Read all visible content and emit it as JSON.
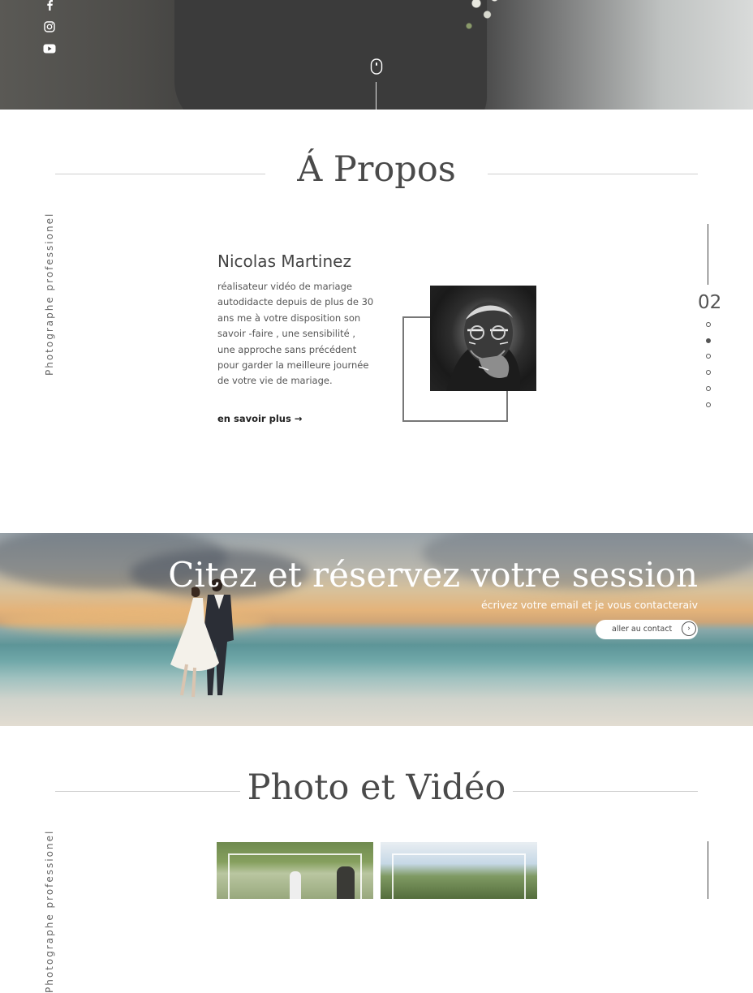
{
  "hero": {
    "social_icons": [
      "facebook-icon",
      "instagram-icon",
      "youtube-icon"
    ],
    "scroll_icon": "mouse-scroll-icon"
  },
  "about": {
    "title": "Á Propos",
    "side_label": "Photographe professionel",
    "name": "Nicolas Martinez",
    "description": "réalisateur vidéo de mariage autodidacte depuis de plus de 30 ans me à votre disposition son savoir -faire , une sensibilité , une approche sans précédent pour garder la meilleure journée de votre vie de mariage.",
    "more_link": "en savoir plus →",
    "portrait": "portrait-photo"
  },
  "pager": {
    "current": "02",
    "total_dots": 6,
    "active_index": 1
  },
  "banner": {
    "title": "Citez et réservez votre session",
    "subtitle": "écrivez votre email  et je vous contacteraiv",
    "button_label": "aller au contact",
    "button_icon": "chevron-right-icon"
  },
  "media": {
    "title": "Photo et Vidéo",
    "side_label": "Photographe professionel"
  },
  "colors": {
    "accent": "#444444",
    "line": "#cfcfcf",
    "text": "#555555"
  }
}
